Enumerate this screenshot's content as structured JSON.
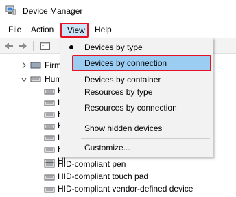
{
  "window": {
    "title": "Device Manager"
  },
  "menu": {
    "file": "File",
    "action": "Action",
    "view": "View",
    "help": "Help"
  },
  "tree": {
    "collapsed_node": "Firm",
    "expanded_node": "Hum",
    "children_partial": [
      "HI",
      "HI",
      "HI",
      "HI",
      "HI",
      "HI",
      "HI",
      "HI"
    ],
    "children_visible": [
      "HID-compliant pen",
      "HID-compliant touch pad",
      "HID-compliant vendor-defined device"
    ]
  },
  "view_menu": {
    "items": [
      {
        "label": "Devices by type",
        "checked": true
      },
      {
        "label": "Devices by connection",
        "highlighted": true
      },
      {
        "label": "Devices by container"
      },
      {
        "label": "Resources by type"
      },
      {
        "label": "Resources by connection"
      },
      {
        "label": "Show hidden devices"
      },
      {
        "label": "Customize..."
      }
    ]
  },
  "colors": {
    "highlight": "#9bcdf3",
    "annotation_border": "#e81123",
    "menu_bg": "#f2f2f2"
  },
  "icons": [
    "device-manager-icon",
    "back-arrow-icon",
    "forward-arrow-icon",
    "properties-icon",
    "chevron-right-icon",
    "chevron-down-icon",
    "hid-device-icon"
  ]
}
